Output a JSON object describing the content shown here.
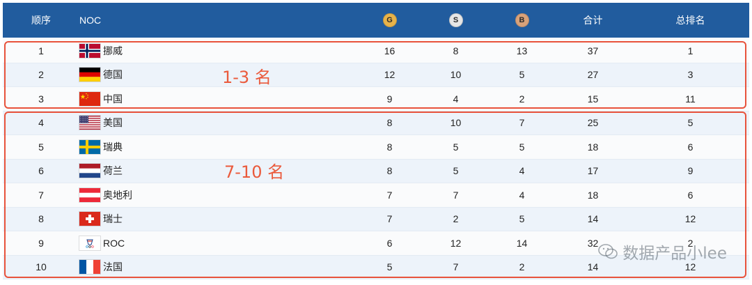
{
  "header": {
    "rank": "顺序",
    "noc": "NOC",
    "gold": "G",
    "silver": "S",
    "bronze": "B",
    "total": "合计",
    "overall": "总排名"
  },
  "colors": {
    "header_bg": "#215c9e",
    "gold": "#e8b34a",
    "silver": "#e6e6e6",
    "bronze": "#d9a27a",
    "highlight": "#e8523b"
  },
  "rows": [
    {
      "rank": "1",
      "flag": "norway-flag",
      "country": "挪威",
      "gold": "16",
      "silver": "8",
      "bronze": "13",
      "total": "37",
      "overall": "1"
    },
    {
      "rank": "2",
      "flag": "germany-flag",
      "country": "德国",
      "gold": "12",
      "silver": "10",
      "bronze": "5",
      "total": "27",
      "overall": "3"
    },
    {
      "rank": "3",
      "flag": "china-flag",
      "country": "中国",
      "gold": "9",
      "silver": "4",
      "bronze": "2",
      "total": "15",
      "overall": "11"
    },
    {
      "rank": "4",
      "flag": "usa-flag",
      "country": "美国",
      "gold": "8",
      "silver": "10",
      "bronze": "7",
      "total": "25",
      "overall": "5"
    },
    {
      "rank": "5",
      "flag": "sweden-flag",
      "country": "瑞典",
      "gold": "8",
      "silver": "5",
      "bronze": "5",
      "total": "18",
      "overall": "6"
    },
    {
      "rank": "6",
      "flag": "netherlands-flag",
      "country": "荷兰",
      "gold": "8",
      "silver": "5",
      "bronze": "4",
      "total": "17",
      "overall": "9"
    },
    {
      "rank": "7",
      "flag": "austria-flag",
      "country": "奥地利",
      "gold": "7",
      "silver": "7",
      "bronze": "4",
      "total": "18",
      "overall": "6"
    },
    {
      "rank": "8",
      "flag": "switzerland-flag",
      "country": "瑞士",
      "gold": "7",
      "silver": "2",
      "bronze": "5",
      "total": "14",
      "overall": "12"
    },
    {
      "rank": "9",
      "flag": "roc-flag",
      "country": "ROC",
      "gold": "6",
      "silver": "12",
      "bronze": "14",
      "total": "32",
      "overall": "2"
    },
    {
      "rank": "10",
      "flag": "france-flag",
      "country": "法国",
      "gold": "5",
      "silver": "7",
      "bronze": "2",
      "total": "14",
      "overall": "12"
    }
  ],
  "annotations": {
    "group1_label": "1-3 名",
    "group2_label": "7-10 名"
  },
  "watermark": {
    "text": "数据产品小lee",
    "icon": "wechat-icon"
  }
}
